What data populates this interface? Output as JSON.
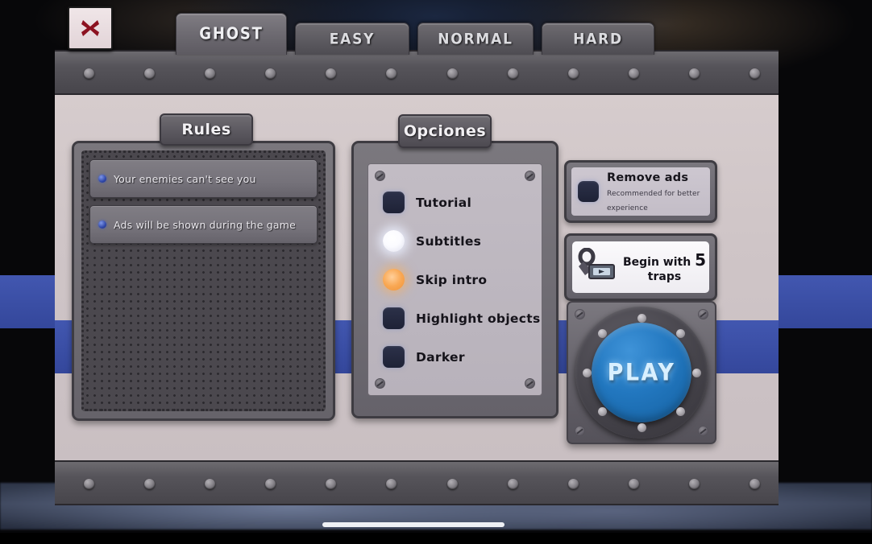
{
  "window": {
    "close_button_icon": "close-x-icon"
  },
  "difficulty_tabs": [
    {
      "label": "GHOST",
      "active": true
    },
    {
      "label": "EASY",
      "active": false
    },
    {
      "label": "NORMAL",
      "active": false
    },
    {
      "label": "HARD",
      "active": false
    }
  ],
  "rules_panel": {
    "title": "Rules",
    "items": [
      {
        "text": "Your enemies can't see you"
      },
      {
        "text": "Ads will be shown during the game"
      }
    ]
  },
  "options_panel": {
    "title": "Opciones",
    "options": [
      {
        "label": "Tutorial",
        "state": "off"
      },
      {
        "label": "Subtitles",
        "state": "on-white"
      },
      {
        "label": "Skip intro",
        "state": "on-orange"
      },
      {
        "label": "Highlight objects",
        "state": "off"
      },
      {
        "label": "Darker",
        "state": "off"
      }
    ]
  },
  "remove_ads": {
    "title": "Remove ads",
    "subtitle": "Recommended for better experience",
    "checkbox_state": "off"
  },
  "traps_offer": {
    "line1_prefix": "Begin with",
    "count": "5",
    "line2": "traps",
    "icon": "bear-trap-icon"
  },
  "play_button": {
    "label": "PLAY"
  },
  "colors": {
    "accent_blue": "#3b4fa6",
    "play_blue": "#2277bf",
    "panel_face": "#cfc5c7",
    "metal_dark": "#4b484e",
    "toggle_on_orange": "#f9a854",
    "close_red": "#8c1220"
  }
}
